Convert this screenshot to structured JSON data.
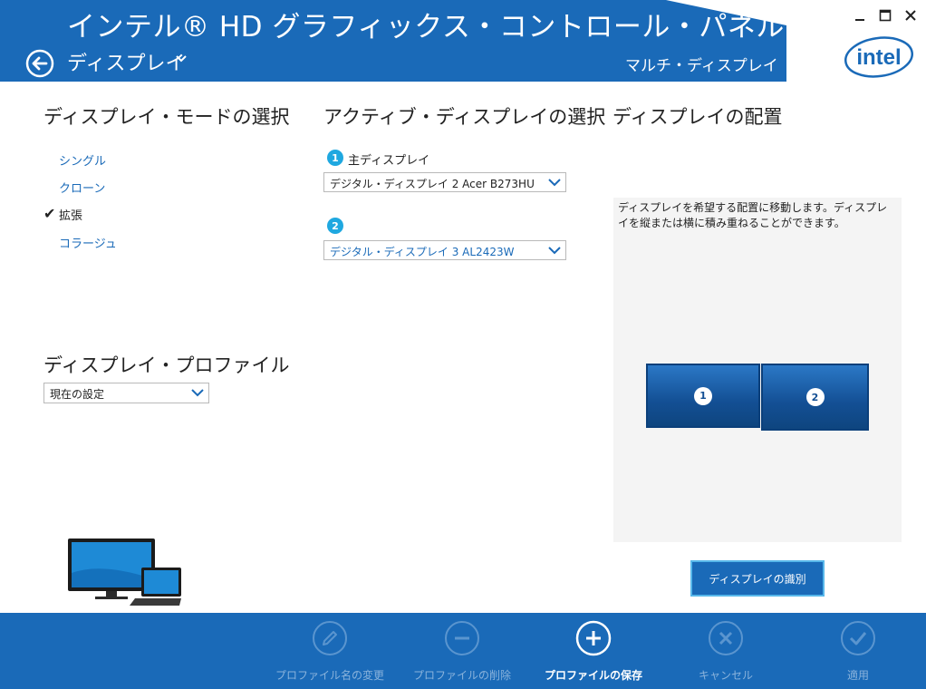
{
  "header": {
    "app_title": "インテル® HD グラフィックス・コントロール・パネル",
    "section": "ディスプレイ",
    "subsection": "マルチ・ディスプレイ",
    "logo_text": "intel"
  },
  "display_mode": {
    "heading": "ディスプレイ・モードの選択",
    "options": [
      {
        "label": "シングル",
        "selected": false
      },
      {
        "label": "クローン",
        "selected": false
      },
      {
        "label": "拡張",
        "selected": true
      },
      {
        "label": "コラージュ",
        "selected": false
      }
    ]
  },
  "active_display": {
    "heading": "アクティブ・ディスプレイの選択",
    "display1": {
      "number": "1",
      "label": "主ディスプレイ",
      "value": "デジタル・ディスプレイ 2 Acer B273HU"
    },
    "display2": {
      "number": "2",
      "value": "デジタル・ディスプレイ 3 AL2423W"
    }
  },
  "profile": {
    "heading": "ディスプレイ・プロファイル",
    "value": "現在の設定"
  },
  "arrangement": {
    "heading": "ディスプレイの配置",
    "instructions": "ディスプレイを希望する配置に移動します。ディスプレイを縦または横に積み重ねることができます。",
    "monitors": [
      "1",
      "2"
    ],
    "identify_button": "ディスプレイの識別"
  },
  "footer": {
    "buttons": [
      {
        "label": "プロファイル名の変更",
        "icon": "pencil-icon",
        "enabled": false
      },
      {
        "label": "プロファイルの削除",
        "icon": "minus-icon",
        "enabled": false
      },
      {
        "label": "プロファイルの保存",
        "icon": "plus-icon",
        "enabled": true
      },
      {
        "label": "キャンセル",
        "icon": "x-icon",
        "enabled": false
      },
      {
        "label": "適用",
        "icon": "check-icon",
        "enabled": false
      }
    ]
  },
  "colors": {
    "brand_blue": "#1a6ab8",
    "accent_cyan": "#1fa8e0",
    "monitor_blue": "#134f94"
  }
}
